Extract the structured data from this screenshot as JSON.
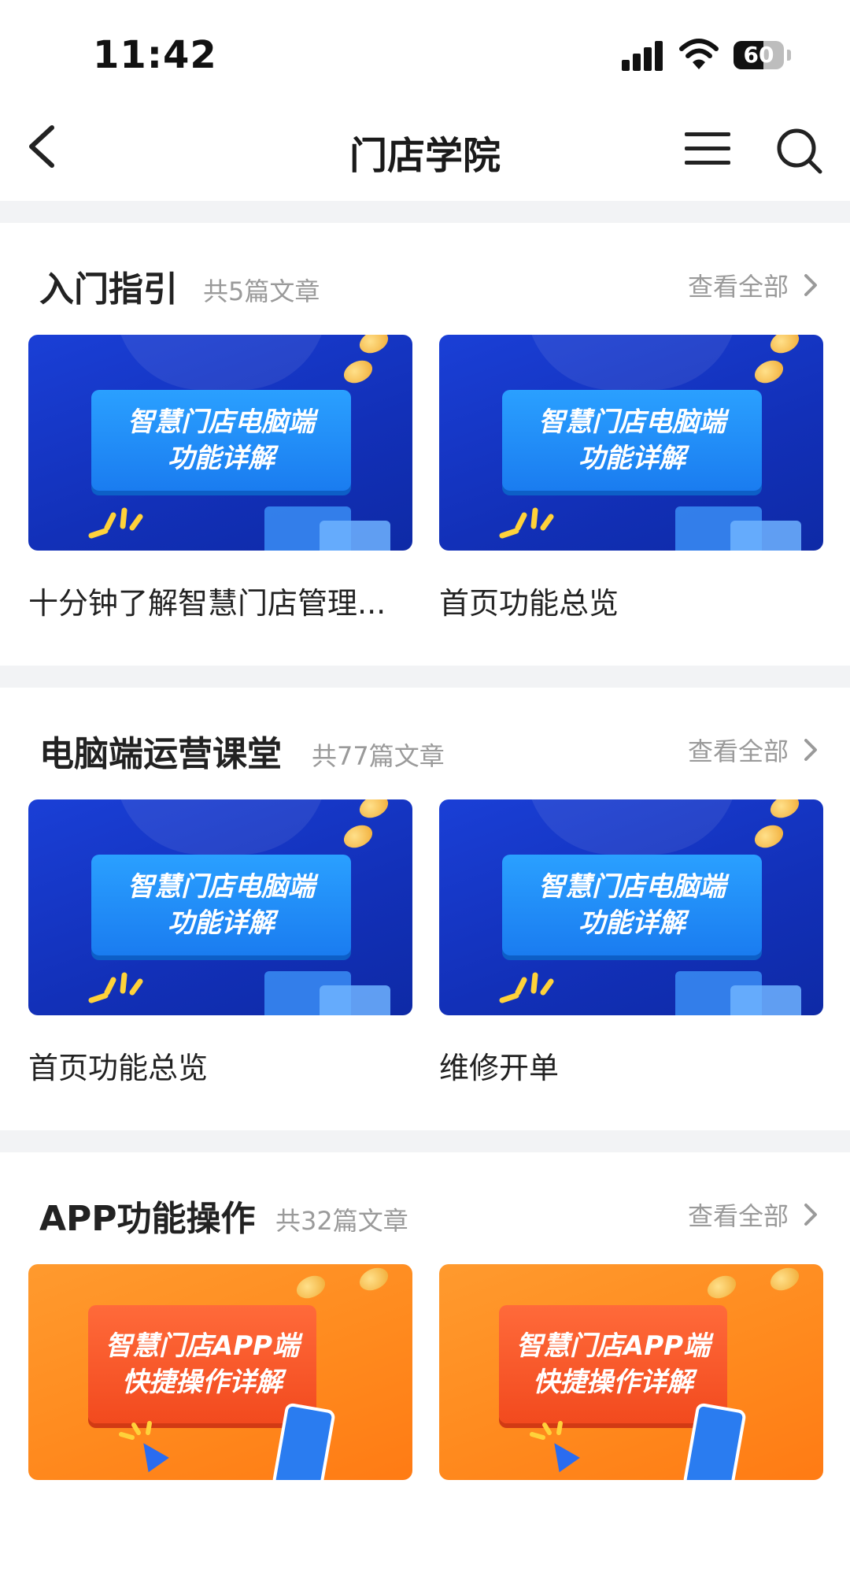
{
  "status_bar": {
    "time": "11:42",
    "battery_level": "60"
  },
  "nav": {
    "title": "门店学院"
  },
  "view_all_label": "查看全部",
  "sections": [
    {
      "title": "入门指引",
      "count": "共5篇文章",
      "cards": [
        {
          "title": "十分钟了解智慧门店管理...",
          "thumb_line1": "智慧门店电脑端",
          "thumb_line2": "功能详解"
        },
        {
          "title": "首页功能总览",
          "thumb_line1": "智慧门店电脑端",
          "thumb_line2": "功能详解"
        }
      ]
    },
    {
      "title": "电脑端运营课堂",
      "count": "共77篇文章",
      "cards": [
        {
          "title": "首页功能总览",
          "thumb_line1": "智慧门店电脑端",
          "thumb_line2": "功能详解"
        },
        {
          "title": "维修开单",
          "thumb_line1": "智慧门店电脑端",
          "thumb_line2": "功能详解"
        }
      ]
    },
    {
      "title": "APP功能操作",
      "count": "共32篇文章",
      "cards": [
        {
          "title": "",
          "thumb_line1": "智慧门店APP端",
          "thumb_line2": "快捷操作详解"
        },
        {
          "title": "",
          "thumb_line1": "智慧门店APP端",
          "thumb_line2": "快捷操作详解"
        }
      ]
    }
  ],
  "colors": {
    "blue_thumb": "#1a3fd6",
    "orange_thumb": "#ff8a1e",
    "gap": "#f2f3f5",
    "muted_text": "#9a9a9a"
  },
  "icons": [
    "back-icon",
    "menu-icon",
    "search-icon",
    "chevron-right-icon",
    "signal-icon",
    "wifi-icon",
    "battery-icon"
  ]
}
